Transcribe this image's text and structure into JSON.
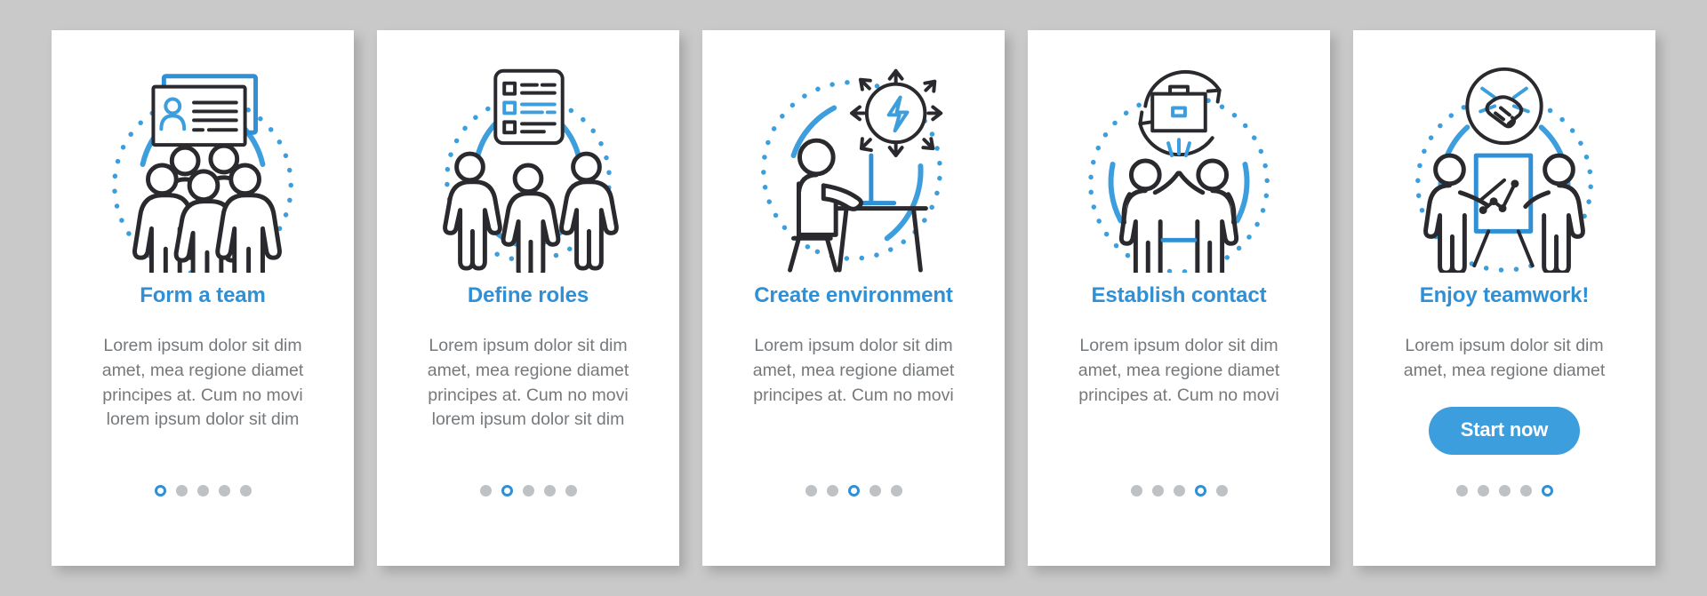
{
  "background_color": "#c9c9c9",
  "accent_color": "#2f90d6",
  "button_color": "#3d9ede",
  "body_text_color": "#76797c",
  "cards": [
    {
      "title": "Form a team",
      "body": "Lorem ipsum dolor sit dim amet, mea regione diamet principes at. Cum no movi lorem ipsum dolor sit dim",
      "illustration": "team-badge-icon",
      "dots_total": 5,
      "dots_active": 1,
      "has_button": false,
      "button_label": ""
    },
    {
      "title": "Define roles",
      "body": "Lorem ipsum dolor sit dim amet, mea regione diamet principes at. Cum no movi lorem ipsum dolor sit dim",
      "illustration": "checklist-people-icon",
      "dots_total": 5,
      "dots_active": 2,
      "has_button": false,
      "button_label": ""
    },
    {
      "title": "Create environment",
      "body": "Lorem ipsum dolor sit dim amet, mea regione diamet principes at. Cum no movi",
      "illustration": "desk-idea-icon",
      "dots_total": 5,
      "dots_active": 3,
      "has_button": false,
      "button_label": ""
    },
    {
      "title": "Establish contact",
      "body": "Lorem ipsum dolor sit dim amet, mea regione diamet principes at. Cum no movi",
      "illustration": "highfive-briefcase-icon",
      "dots_total": 5,
      "dots_active": 4,
      "has_button": false,
      "button_label": ""
    },
    {
      "title": "Enjoy teamwork!",
      "body": "Lorem ipsum dolor sit dim amet, mea regione diamet",
      "illustration": "presentation-handshake-icon",
      "dots_total": 5,
      "dots_active": 5,
      "has_button": true,
      "button_label": "Start now"
    }
  ]
}
